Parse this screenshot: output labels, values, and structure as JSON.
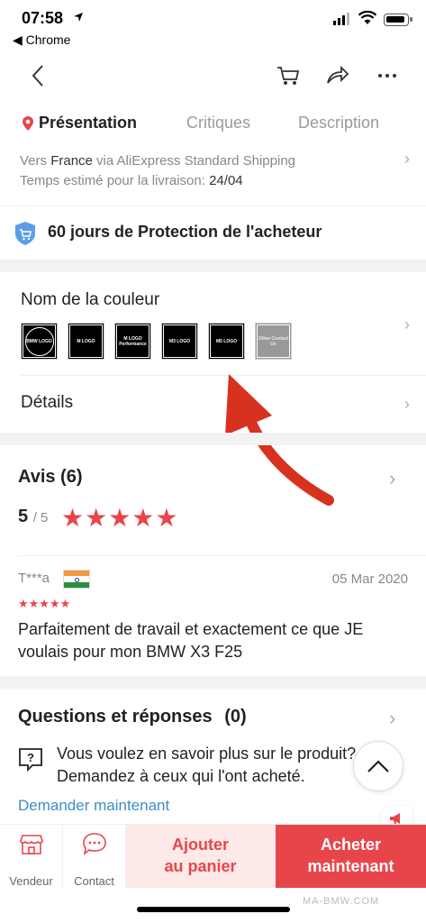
{
  "status_bar": {
    "time": "07:58",
    "back_app": "◀ Chrome"
  },
  "tabs": [
    {
      "label": "Présentation"
    },
    {
      "label": "Critiques"
    },
    {
      "label": "Description"
    }
  ],
  "shipping": {
    "line1_prefix": "Vers ",
    "line1_country": "France",
    "line1_suffix": " via AliExpress Standard Shipping",
    "line2_prefix": "Temps estimé pour la livraison: ",
    "line2_date": "24/04"
  },
  "protection": {
    "text": "60 jours de Protection de l'acheteur"
  },
  "colour_section": {
    "title": "Nom de la couleur",
    "options": [
      "BMW LOGO",
      "M LOGO",
      "M LOGO Performance",
      "M3 LOGO",
      "M5 LOGO",
      "Other Contact Us"
    ]
  },
  "details": {
    "title": "Détails"
  },
  "reviews": {
    "title": "Avis (6)",
    "score": "5",
    "out_of": "/ 5",
    "stars": "★★★★★",
    "item": {
      "author": "T***a",
      "date": "05 Mar 2020",
      "stars": "★★★★★",
      "text": "Parfaitement de travail et exactement ce que JE voulais pour mon BMW X3 F25"
    }
  },
  "qa": {
    "title": "Questions et réponses",
    "count": "(0)",
    "text": "Vous voulez en savoir plus sur le produit? Demandez à ceux qui l'ont acheté.",
    "link": "Demander maintenant"
  },
  "bottom_bar": {
    "seller": "Vendeur",
    "contact": "Contact",
    "add_to_cart_line1": "Ajouter",
    "add_to_cart_line2": "au panier",
    "buy_line1": "Acheter",
    "buy_line2": "maintenant"
  },
  "watermark": "MA-BMW.COM",
  "colors": {
    "accent": "#e8454b",
    "link": "#3b8fc6",
    "band": "#f2f2f2"
  }
}
